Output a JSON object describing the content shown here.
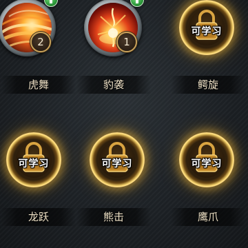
{
  "skills": [
    {
      "name": "虎舞",
      "state": "learned",
      "level": "2",
      "upgrade_icon": "green-up-arrow-icon",
      "art": "orange-swirl"
    },
    {
      "name": "豹袭",
      "state": "learned",
      "level": "1",
      "upgrade_icon": "green-up-arrow-icon",
      "art": "red-flame-burst"
    },
    {
      "name": "鳄旋",
      "state": "locked",
      "status_label": "可学习",
      "icon": "padlock-icon"
    },
    {
      "name": "龙跃",
      "state": "locked",
      "status_label": "可学习",
      "icon": "padlock-icon"
    },
    {
      "name": "熊击",
      "state": "locked",
      "status_label": "可学习",
      "icon": "padlock-icon"
    },
    {
      "name": "鹰爪",
      "state": "locked",
      "status_label": "可学习",
      "icon": "padlock-icon"
    }
  ],
  "colors": {
    "ring_gold": "#f6d36b",
    "name_text": "#ecdfc4",
    "upgrade_green": "#2f9a3d",
    "background": "#1c2024"
  }
}
